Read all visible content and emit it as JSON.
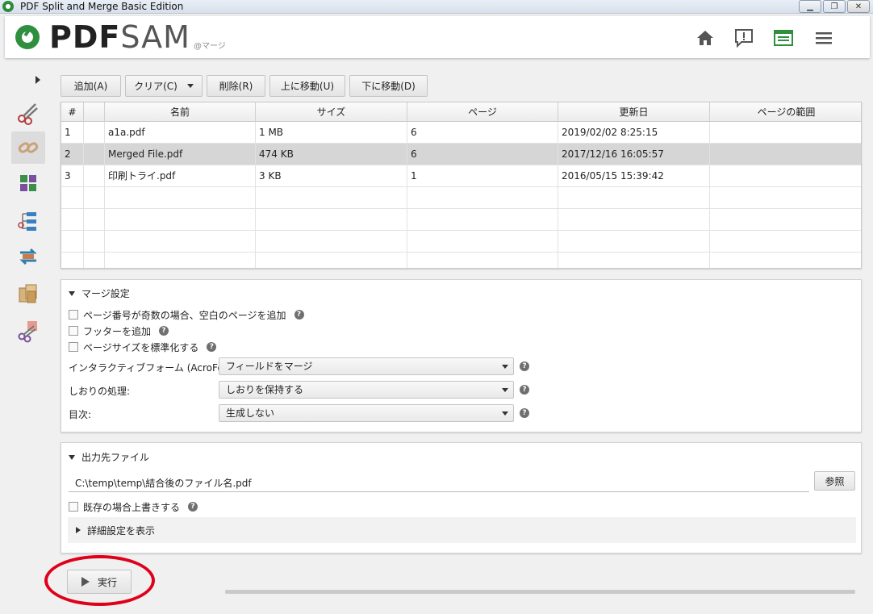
{
  "window": {
    "title": "PDF Split and Merge Basic Edition",
    "minimize": "▁",
    "maximize": "❐",
    "close": "✕"
  },
  "header": {
    "logo_pdf": "PDF",
    "logo_sam": "SAM",
    "subtitle": "@マージ",
    "icons": [
      "home-icon",
      "feedback-icon",
      "news-icon",
      "menu-icon"
    ]
  },
  "sidebar": {
    "tools": [
      "split-icon",
      "merge-icon",
      "alternate-mix-icon",
      "split-by-bookmarks-icon",
      "rotate-icon",
      "extract-icon",
      "split-by-size-icon"
    ],
    "active_index": 1
  },
  "toolbar": {
    "add": "追加(A)",
    "clear": "クリア(C)",
    "remove": "削除(R)",
    "move_up": "上に移動(U)",
    "move_down": "下に移動(D)"
  },
  "table": {
    "columns": [
      "#",
      "",
      "名前",
      "サイズ",
      "ページ",
      "更新日",
      "ページの範囲"
    ],
    "rows": [
      {
        "num": "1",
        "name": "a1a.pdf",
        "size": "1 MB",
        "pages": "6",
        "modified": "2019/02/02 8:25:15",
        "range": ""
      },
      {
        "num": "2",
        "name": "Merged File.pdf",
        "size": "474 KB",
        "pages": "6",
        "modified": "2017/12/16 16:05:57",
        "range": ""
      },
      {
        "num": "3",
        "name": "印刷トライ.pdf",
        "size": "3 KB",
        "pages": "1",
        "modified": "2016/05/15 15:39:42",
        "range": ""
      }
    ],
    "selected_row": 1
  },
  "merge_settings": {
    "title": "マージ設定",
    "blank_page_label": "ページ番号が奇数の場合、空白のページを追加",
    "footer_label": "フッターを追加",
    "normalize_label": "ページサイズを標準化する",
    "acroforms_label": "インタラクティブフォーム (AcroForms):",
    "acroforms_value": "フィールドをマージ",
    "bookmarks_label": "しおりの処理:",
    "bookmarks_value": "しおりを保持する",
    "toc_label": "目次:",
    "toc_value": "生成しない",
    "help": "?"
  },
  "output": {
    "title": "出力先ファイル",
    "path": "C:\\temp\\temp\\結合後のファイル名.pdf",
    "browse": "参照",
    "overwrite_label": "既存の場合上書きする",
    "advanced_label": "詳細設定を表示"
  },
  "run": {
    "label": "実行",
    "progress": 0
  }
}
